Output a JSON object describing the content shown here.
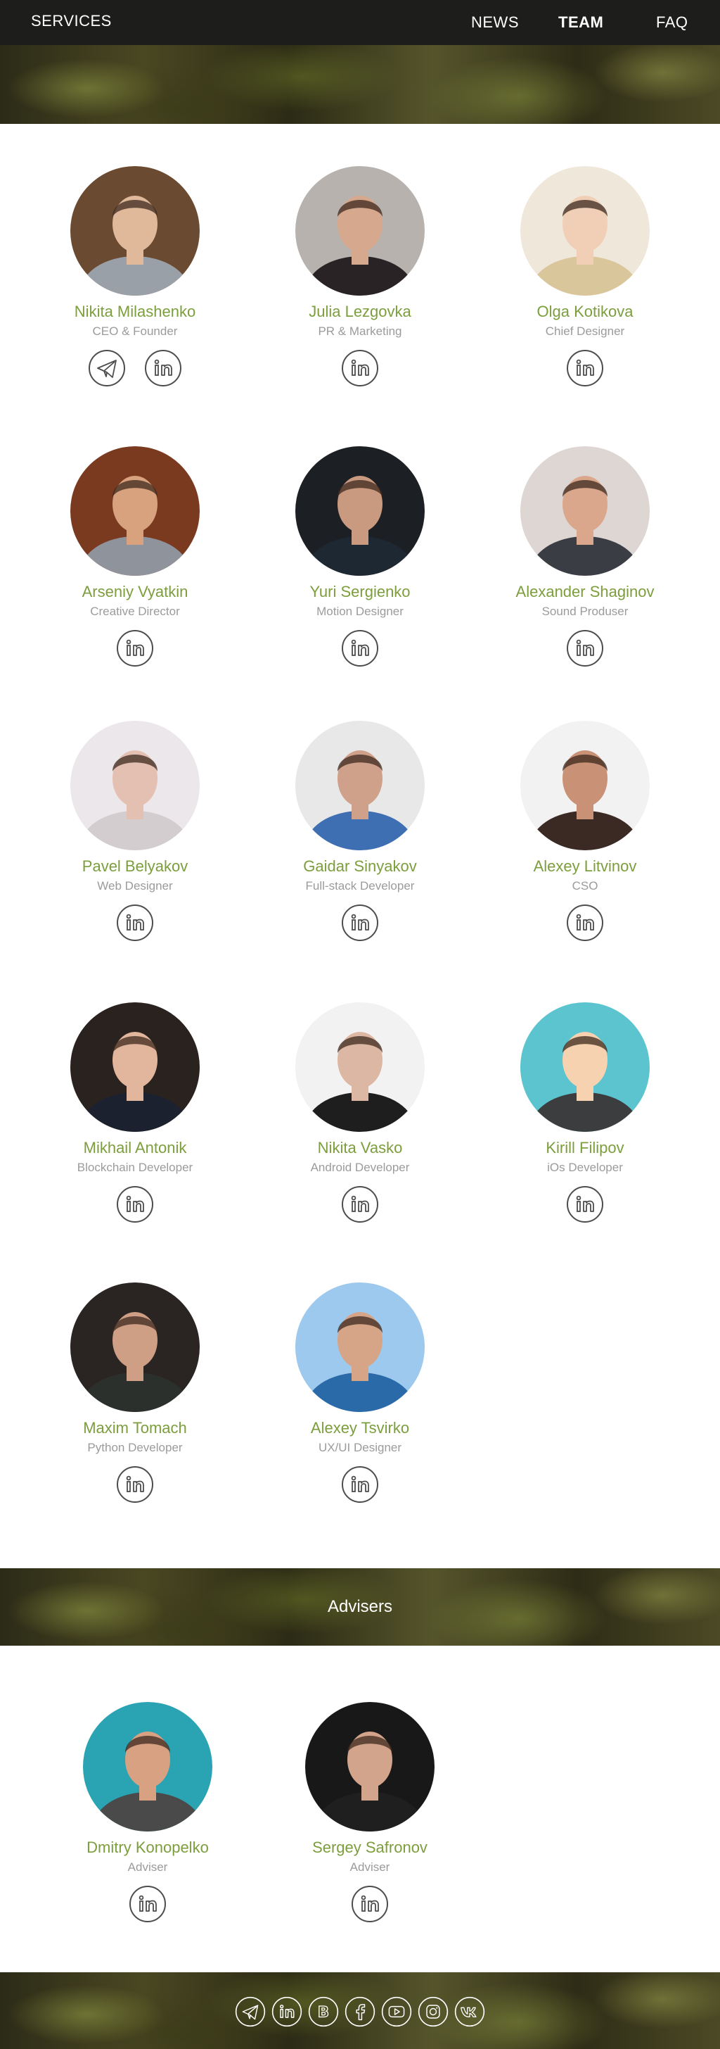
{
  "nav": {
    "services": "SERVICES",
    "news": "NEWS",
    "team": "TEAM",
    "faq": "FAQ"
  },
  "team": [
    {
      "name": "Nikita Milashenko",
      "role": "CEO & Founder",
      "socials": [
        "telegram-icon",
        "linkedin-icon"
      ],
      "bg": "#6b4a32",
      "skin": "#e0b89a",
      "shirt": "#9aa0a8"
    },
    {
      "name": "Julia Lezgovka",
      "role": "PR & Marketing",
      "socials": [
        "linkedin-icon"
      ],
      "bg": "#b7b2ae",
      "skin": "#d6a98e",
      "shirt": "#2a2326"
    },
    {
      "name": "Olga Kotikova",
      "role": "Chief Designer",
      "socials": [
        "linkedin-icon"
      ],
      "bg": "#efe7d9",
      "skin": "#f0cfb6",
      "shirt": "#d9c69a"
    },
    {
      "name": "Arseniy Vyatkin",
      "role": "Creative Director",
      "socials": [
        "linkedin-icon"
      ],
      "bg": "#7a3a20",
      "skin": "#d9a27e",
      "shirt": "#8f949c"
    },
    {
      "name": "Yuri Sergienko",
      "role": "Motion Designer",
      "socials": [
        "linkedin-icon"
      ],
      "bg": "#1c1f24",
      "skin": "#c99a80",
      "shirt": "#1e2833"
    },
    {
      "name": "Alexander Shaginov",
      "role": "Sound Produser",
      "socials": [
        "linkedin-icon"
      ],
      "bg": "#ddd6d3",
      "skin": "#dba78c",
      "shirt": "#3a3d43"
    },
    {
      "name": "Pavel Belyakov",
      "role": "Web Designer",
      "socials": [
        "linkedin-icon"
      ],
      "bg": "#ece7ea",
      "skin": "#e4c0b3",
      "shirt": "#d3cdd0"
    },
    {
      "name": "Gaidar Sinyakov",
      "role": "Full-stack Developer",
      "socials": [
        "linkedin-icon"
      ],
      "bg": "#e8e8e8",
      "skin": "#cfa08a",
      "shirt": "#3e6fb3"
    },
    {
      "name": "Alexey Litvinov",
      "role": "CSO",
      "socials": [
        "linkedin-icon"
      ],
      "bg": "#f2f2f2",
      "skin": "#c99176",
      "shirt": "#3b2a23"
    },
    {
      "name": "Mikhail Antonik",
      "role": "Blockchain Developer",
      "socials": [
        "linkedin-icon"
      ],
      "bg": "#2a221f",
      "skin": "#e2b59d",
      "shirt": "#1c2130"
    },
    {
      "name": "Nikita Vasko",
      "role": "Android Developer",
      "socials": [
        "linkedin-icon"
      ],
      "bg": "#f2f2f2",
      "skin": "#dcb7a4",
      "shirt": "#1e1e1e"
    },
    {
      "name": "Kirill Filipov",
      "role": "iOs Developer",
      "socials": [
        "linkedin-icon"
      ],
      "bg": "#5bc4cf",
      "skin": "#f6d2b0",
      "shirt": "#3c3d3f"
    },
    {
      "name": "Maxim Tomach",
      "role": "Python Developer",
      "socials": [
        "linkedin-icon"
      ],
      "bg": "#2a2522",
      "skin": "#cf9f85",
      "shirt": "#2c302d"
    },
    {
      "name": "Alexey Tsvirko",
      "role": "UX/UI Designer",
      "socials": [
        "linkedin-icon"
      ],
      "bg": "#9ec9ee",
      "skin": "#d6a487",
      "shirt": "#2b6aa8"
    }
  ],
  "advisers_title": "Advisers",
  "advisers": [
    {
      "name": "Dmitry Konopelko",
      "role": "Adviser",
      "socials": [
        "linkedin-icon"
      ],
      "bg": "#2aa3b3",
      "skin": "#d7a182",
      "shirt": "#4a4a4a"
    },
    {
      "name": "Sergey Safronov",
      "role": "Adviser",
      "socials": [
        "linkedin-icon"
      ],
      "bg": "#181818",
      "skin": "#d2a48c",
      "shirt": "#1f1f1f"
    }
  ],
  "footer_socials": [
    "telegram-icon",
    "linkedin-icon",
    "bitcoin-icon",
    "facebook-icon",
    "youtube-icon",
    "instagram-icon",
    "vk-icon"
  ],
  "colors": {
    "accent_green": "#7c9e3d",
    "role_gray": "#9b9b9b",
    "nav_bg": "#1d1d1b"
  }
}
